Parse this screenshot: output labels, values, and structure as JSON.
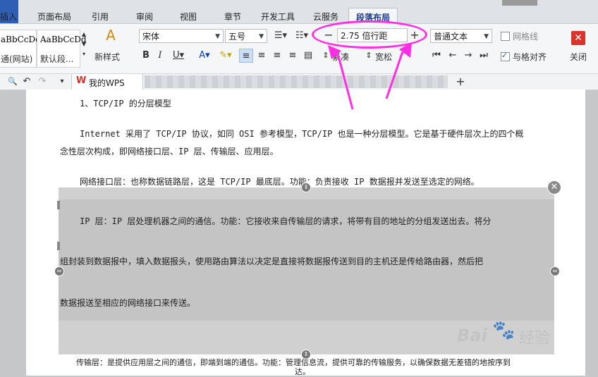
{
  "ribbon_tabs": [
    "插入",
    "页面布局",
    "引用",
    "审阅",
    "视图",
    "章节",
    "开发工具",
    "云服务",
    "段落布局"
  ],
  "styles": [
    {
      "sample": "aBbCcDd",
      "name": "通(网站)"
    },
    {
      "sample": "AaBbCcDd",
      "name": "默认段..."
    }
  ],
  "new_style_label": "新样式",
  "font": {
    "family": "宋体",
    "size": "五号"
  },
  "line_spacing": {
    "value": "2.75 倍行距",
    "tighter": "紧凑",
    "looser": "宽松"
  },
  "paragraph_style": "普通文本",
  "grid": {
    "gridlines": "网格线",
    "align_to_grid": "与格对齐",
    "gridlines_checked": false,
    "align_checked": true
  },
  "close_label": "关闭",
  "doc_tab_label": "我的WPS",
  "document": {
    "heading": "1、TCP/IP 的分层模型",
    "p1_line1": "Internet 采用了 TCP/IP 协议，如同 OSI 参考模型，TCP/IP 也是一种分层模型。它是基于硬件层次上的四个概",
    "p1_line2": "念性层次构成，即网络接口层、IP 层、传输层、应用层。",
    "p2": "网络接口层：也称数据链路层，这是 TCP/IP 最底层。功能：负责接收 IP 数据报并发送至选定的网络。",
    "p3_line1": "IP 层：IP 层处理机器之间的通信。功能：它接收来自传输层的请求，将带有目的地址的分组发送出去。将分",
    "p3_line2": "组封装到数据报中，填入数据报头，使用路由算法以决定是直接将数据报传送到目的主机还是传给路由器，然后把",
    "p3_line3": "数据报送至相应的网络接口来传送。",
    "p4_line1": "传输层：是提供应用层之间的通信，即端到端的通信。功能：管理信息流，提供可靠的传输服务，以确保数据无差错的地按序到",
    "p4_line2": "达。"
  },
  "watermark": {
    "brand": "Bai",
    "sub": "经验"
  },
  "colors": {
    "accent_tab": "#1f3d8a",
    "highlight": "#ff2ee6",
    "close": "#d9342b",
    "selection": "#c4c4c4"
  }
}
